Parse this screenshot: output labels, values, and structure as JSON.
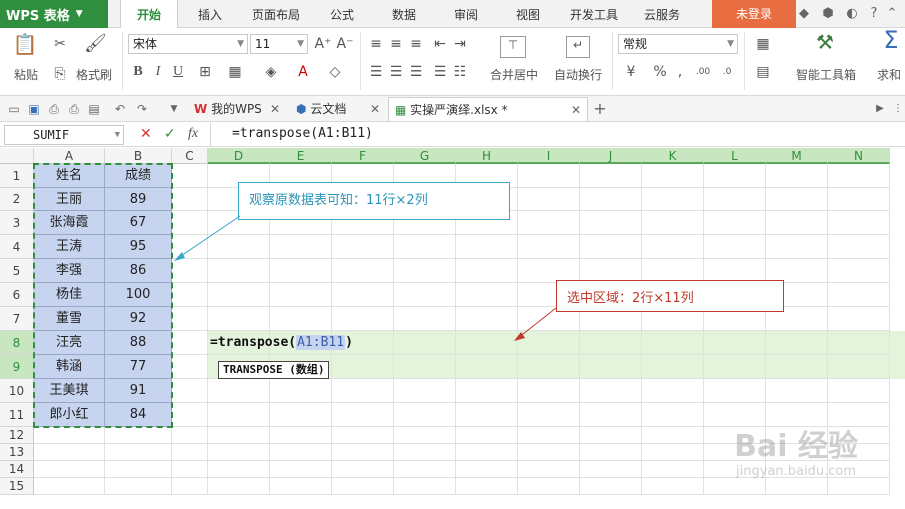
{
  "app": {
    "logo": "WPS 表格",
    "login": "未登录"
  },
  "ribbon_tabs": [
    "开始",
    "插入",
    "页面布局",
    "公式",
    "数据",
    "审阅",
    "视图",
    "开发工具",
    "云服务"
  ],
  "ribbon": {
    "paste": "粘贴",
    "format_painter": "格式刷",
    "font_name": "宋体",
    "font_size": "11",
    "merge_center": "合并居中",
    "wrap_text": "自动换行",
    "number_format": "常规",
    "toolbox": "智能工具箱",
    "sum": "求和",
    "bold": "B",
    "italic": "I",
    "underline": "U"
  },
  "doc_tabs": [
    {
      "label": "我的WPS",
      "active": false
    },
    {
      "label": "云文档",
      "active": false
    },
    {
      "label": "实操严演绎.xlsx *",
      "active": true
    }
  ],
  "formula_bar": {
    "name_box": "SUMIF",
    "fx": "fx",
    "formula": "=transpose(A1:B11)"
  },
  "columns": [
    "A",
    "B",
    "C",
    "D",
    "E",
    "F",
    "G",
    "H",
    "I",
    "J",
    "K",
    "L",
    "M",
    "N"
  ],
  "rows": [
    "1",
    "2",
    "3",
    "4",
    "5",
    "6",
    "7",
    "8",
    "9",
    "10",
    "11",
    "12",
    "13",
    "14",
    "15"
  ],
  "table": {
    "headers": [
      "姓名",
      "成绩"
    ],
    "records": [
      [
        "王丽",
        "89"
      ],
      [
        "张海霞",
        "67"
      ],
      [
        "王涛",
        "95"
      ],
      [
        "李强",
        "86"
      ],
      [
        "杨佳",
        "100"
      ],
      [
        "董雪",
        "92"
      ],
      [
        "汪亮",
        "88"
      ],
      [
        "韩涵",
        "77"
      ],
      [
        "王美琪",
        "91"
      ],
      [
        "郎小红",
        "84"
      ]
    ]
  },
  "editing": {
    "prefix": "=transpose(",
    "ref": "A1:B11",
    "suffix": ")",
    "tooltip": "TRANSPOSE (数组)"
  },
  "callouts": {
    "observe": "观察原数据表可知：11行×2列",
    "select": "选中区域：2行×11列"
  },
  "watermark": {
    "brand": "Bai 经验",
    "url": "jingyan.baidu.com"
  },
  "colors": {
    "accent": "#2f8f3e",
    "login": "#e86e42",
    "data_fill": "#c6d4ef",
    "selected_range": "#e4f3dc",
    "callout_blue": "#3aa6c8",
    "callout_red": "#c0392b"
  }
}
